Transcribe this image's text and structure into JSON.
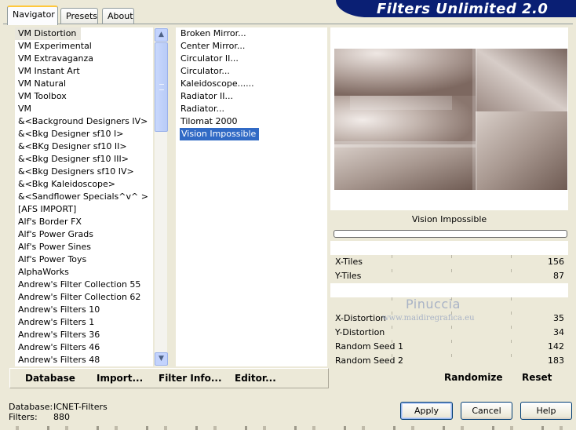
{
  "tabs": [
    "Navigator",
    "Presets",
    "About"
  ],
  "banner": "Filters Unlimited 2.0",
  "categories": [
    "VM Distortion",
    "VM Experimental",
    "VM Extravaganza",
    "VM Instant Art",
    "VM Natural",
    "VM Toolbox",
    "VM",
    "&<Background Designers IV>",
    "&<Bkg Designer sf10 I>",
    "&<BKg Designer sf10 II>",
    "&<Bkg Designer sf10 III>",
    "&<Bkg Designers sf10 IV>",
    "&<Bkg Kaleidoscope>",
    "&<Sandflower Specials^v^ >",
    "[AFS IMPORT]",
    "Alf's Border FX",
    "Alf's Power Grads",
    "Alf's Power Sines",
    "Alf's Power Toys",
    "AlphaWorks",
    "Andrew's Filter Collection 55",
    "Andrew's Filter Collection 62",
    "Andrew's Filters 10",
    "Andrew's Filters 1",
    "Andrew's Filters 36",
    "Andrew's Filters 46",
    "Andrew's Filters 48"
  ],
  "selected_category": "VM Distortion",
  "filters": [
    "Broken Mirror...",
    "Center Mirror...",
    "Circulator II...",
    "Circulator...",
    "Kaleidoscope......",
    "Radiator II...",
    "Radiator...",
    "Tilomat 2000",
    "Vision Impossible"
  ],
  "selected_filter": "Vision Impossible",
  "filter_title": "Vision Impossible",
  "params": [
    {
      "name": "X-Tiles",
      "value": "156"
    },
    {
      "name": "Y-Tiles",
      "value": "87"
    },
    {
      "name": "X-Distortion",
      "value": "35"
    },
    {
      "name": "Y-Distortion",
      "value": "34"
    },
    {
      "name": "Random Seed 1",
      "value": "142"
    },
    {
      "name": "Random Seed 2",
      "value": "183"
    }
  ],
  "watermark": {
    "line1": "Pinuccia",
    "line2": "www.maidiregrafica.eu"
  },
  "toolbar": {
    "database": "Database",
    "import": "Import...",
    "filter_info": "Filter Info...",
    "editor": "Editor...",
    "randomize": "Randomize",
    "reset": "Reset"
  },
  "status": {
    "database_label": "Database:",
    "database_value": "ICNET-Filters",
    "filters_label": "Filters:",
    "filters_value": "880"
  },
  "buttons": {
    "apply": "Apply",
    "cancel": "Cancel",
    "help": "Help"
  },
  "colors": {
    "banner_bg": "#0a1f74",
    "selection": "#316ac5",
    "preview_tone": "#8c7a72"
  }
}
